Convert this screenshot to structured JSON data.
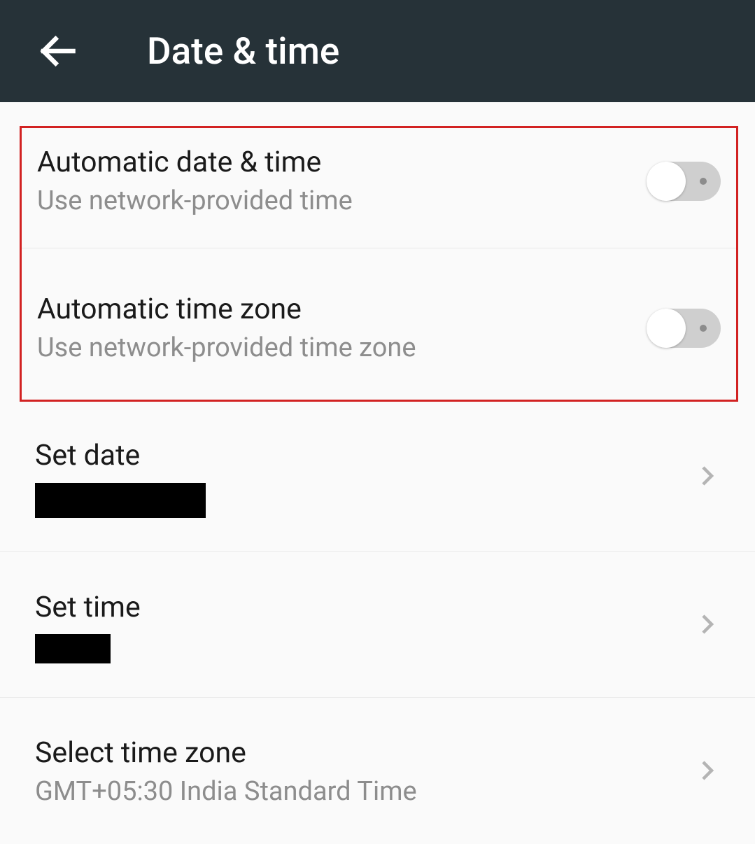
{
  "header": {
    "title": "Date & time"
  },
  "settings": {
    "auto_date_time": {
      "title": "Automatic date & time",
      "subtitle": "Use network-provided time",
      "on": false
    },
    "auto_time_zone": {
      "title": "Automatic time zone",
      "subtitle": "Use network-provided time zone",
      "on": false
    },
    "set_date": {
      "title": "Set date"
    },
    "set_time": {
      "title": "Set time"
    },
    "time_zone": {
      "title": "Select time zone",
      "subtitle": "GMT+05:30 India Standard Time"
    }
  }
}
